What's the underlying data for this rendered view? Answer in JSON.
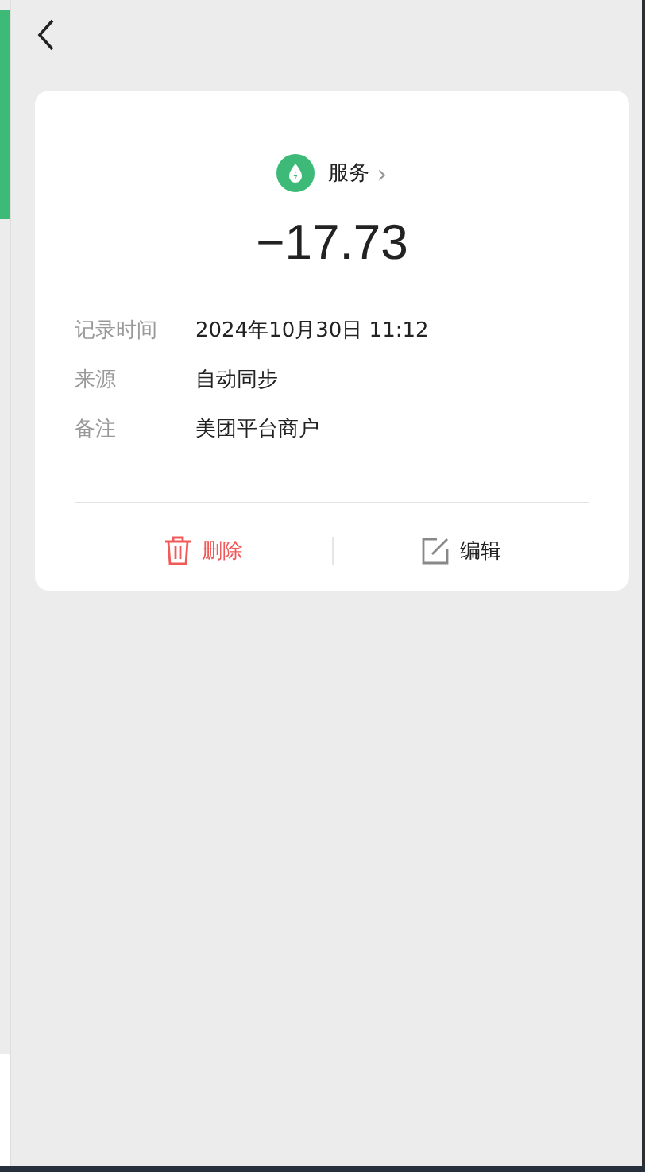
{
  "category": {
    "name": "服务",
    "chevron": "›"
  },
  "amount": "−17.73",
  "details": [
    {
      "label": "记录时间",
      "value": "2024年10月30日 11:12"
    },
    {
      "label": "来源",
      "value": "自动同步"
    },
    {
      "label": "备注",
      "value": "美团平台商户"
    }
  ],
  "actions": [
    {
      "kind": "delete",
      "label": "删除"
    },
    {
      "kind": "edit",
      "label": "编辑"
    }
  ]
}
